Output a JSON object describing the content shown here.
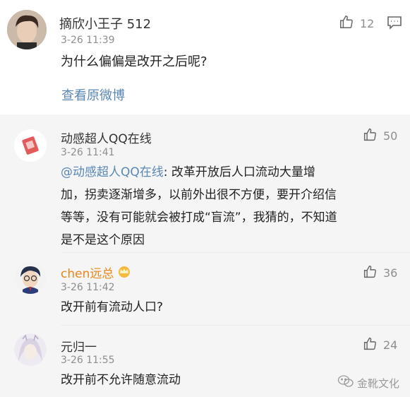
{
  "main_comment": {
    "username": "摘欣小王子 512",
    "time": "3-26 11:39",
    "text": "为什么偏偏是改开之后呢?",
    "likes": "12",
    "view_original": "查看原微博"
  },
  "replies": [
    {
      "username": "动感超人QQ在线",
      "time": "3-26 11:41",
      "mention": "@动感超人QQ在线",
      "text_line1": ": 改革开放后人口流动大量增",
      "text_line2": "加，拐卖逐渐增多，以前外出很不方便，要开介绍信",
      "text_line3": "等等，没有可能就会被打成“盲流”，我猜的，不知道",
      "text_line4": "是不是这个原因",
      "likes": "50"
    },
    {
      "username": "chen远总",
      "time": "3-26 11:42",
      "text": "改开前有流动人口?",
      "likes": "36"
    },
    {
      "username": "元归一",
      "time": "3-26 11:55",
      "text": "改开前不允许随意流动",
      "likes": "24"
    }
  ],
  "watermark": "金靴文化",
  "icons": {
    "like": "thumbs-up-icon",
    "comment": "comment-icon",
    "vip_badge": "crown-badge-icon",
    "wechat": "wechat-logo-icon"
  },
  "colors": {
    "link": "#5a87b4",
    "username_vip": "#e8861a",
    "reply_bg": "#f5f5f5"
  }
}
